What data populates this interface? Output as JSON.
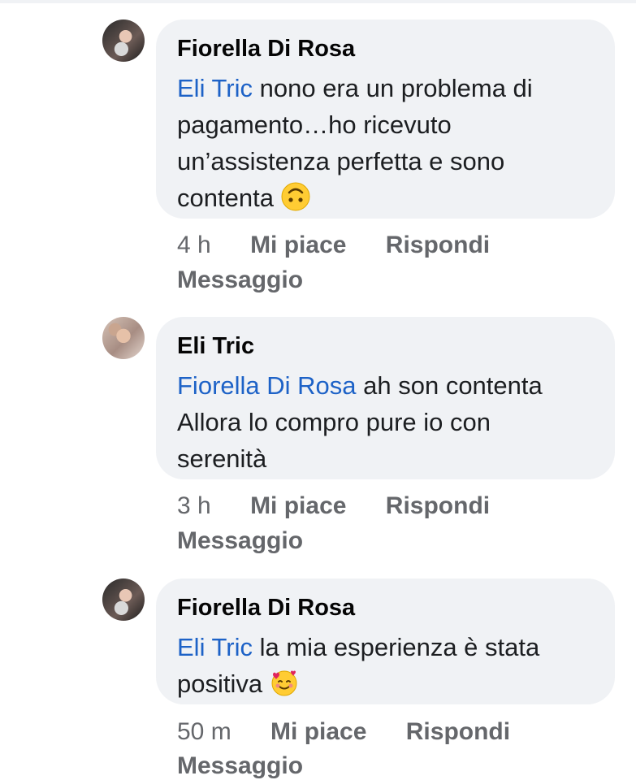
{
  "comments": [
    {
      "author": "Fiorella Di Rosa",
      "mention": "Eli Tric",
      "line1_rest": " nono era un problema di",
      "line2": "pagamento…ho ricevuto",
      "line3": "un’assistenza perfetta e sono",
      "line4": "contenta",
      "emoji_icon": "upside-down-face-emoji",
      "time": "4 h",
      "like": "Mi piace",
      "reply": "Rispondi",
      "message": "Messaggio"
    },
    {
      "author": "Eli Tric",
      "mention": "Fiorella Di Rosa",
      "line1_rest": " ah son contenta",
      "line2": "Allora lo compro pure io con",
      "line3": "serenità",
      "time": "3 h",
      "like": "Mi piace",
      "reply": "Rispondi",
      "message": "Messaggio"
    },
    {
      "author": "Fiorella Di Rosa",
      "mention": "Eli Tric",
      "line1_rest": " la mia esperienza è stata",
      "line2": "positiva",
      "emoji_icon": "smiling-face-with-hearts-emoji",
      "time": "50 m",
      "like": "Mi piace",
      "reply": "Rispondi",
      "message": "Messaggio"
    }
  ],
  "colors": {
    "bubble": "#f0f2f5",
    "mention": "#1d62c7",
    "meta": "#65676b",
    "author": "#050505"
  }
}
